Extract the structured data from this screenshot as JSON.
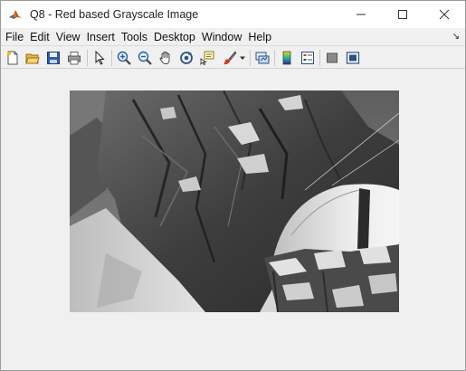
{
  "window": {
    "title": "Q8 - Red based Grayscale Image",
    "app_icon": "matlab-logo-icon"
  },
  "window_controls": {
    "minimize_icon": "minimize-icon",
    "maximize_icon": "maximize-icon",
    "close_icon": "close-icon"
  },
  "menu": {
    "items": [
      "File",
      "Edit",
      "View",
      "Insert",
      "Tools",
      "Desktop",
      "Window",
      "Help"
    ],
    "dock_icon": "dock-arrow-icon"
  },
  "toolbar": {
    "buttons": [
      {
        "icon": "new-figure-icon"
      },
      {
        "icon": "open-file-icon"
      },
      {
        "icon": "save-icon"
      },
      {
        "icon": "print-icon"
      },
      {
        "icon": "edit-plot-arrow-icon"
      },
      {
        "icon": "zoom-in-icon"
      },
      {
        "icon": "zoom-out-icon"
      },
      {
        "icon": "pan-hand-icon"
      },
      {
        "icon": "rotate-3d-icon"
      },
      {
        "icon": "data-cursor-icon"
      },
      {
        "icon": "brush-icon"
      },
      {
        "icon": "brush-dropdown-icon"
      },
      {
        "icon": "link-plot-icon"
      },
      {
        "icon": "insert-colorbar-icon"
      },
      {
        "icon": "insert-legend-icon"
      },
      {
        "icon": "hide-plot-tools-icon"
      },
      {
        "icon": "show-plot-tools-icon"
      }
    ]
  },
  "image": {
    "description_icon": "grayscale-photo-icon",
    "colors": {
      "sky": "#6f6f6f",
      "rock_dark": "#2e2e2e",
      "rock_mid": "#575757",
      "snow": "#d9d9d9",
      "tent": "#e8e8e8"
    }
  }
}
